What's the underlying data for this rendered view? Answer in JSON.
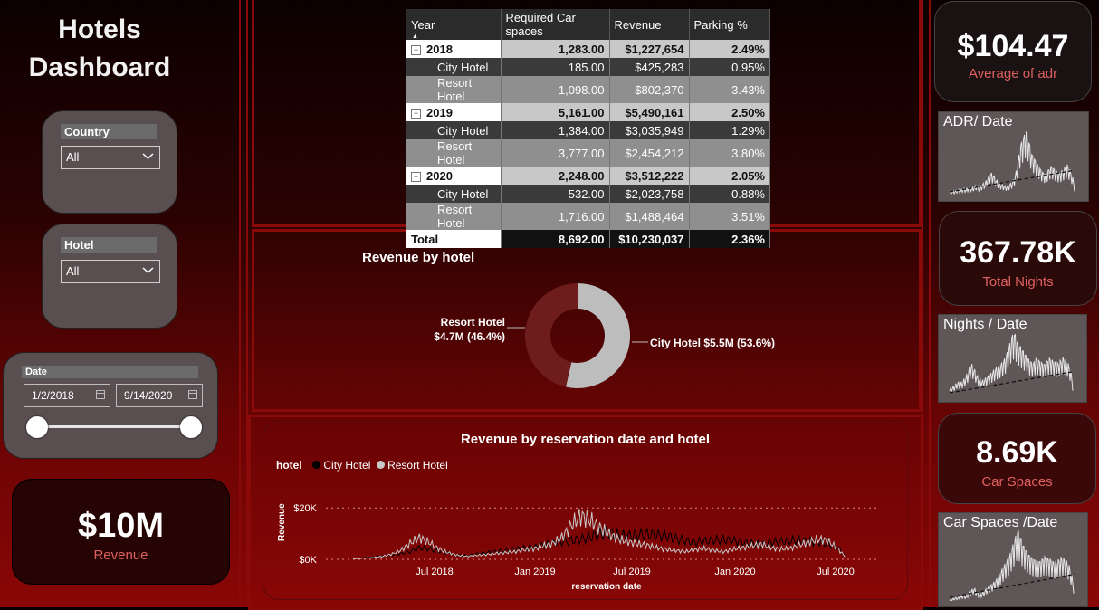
{
  "title": {
    "line1": "Hotels",
    "line2": "Dashboard"
  },
  "slicers": {
    "country": {
      "label": "Country",
      "value": "All"
    },
    "hotel": {
      "label": "Hotel",
      "value": "All"
    },
    "date": {
      "label": "Date",
      "start": "1/2/2018",
      "end": "9/14/2020"
    }
  },
  "revenue_card": {
    "value": "$10M",
    "label": "Revenue"
  },
  "kpis": {
    "adr": {
      "value": "$104.47",
      "label": "Average of adr"
    },
    "nights": {
      "value": "367.78K",
      "label": "Total Nights"
    },
    "car": {
      "value": "8.69K",
      "label": "Car Spaces"
    }
  },
  "mini_charts": {
    "adr": {
      "title": "ADR/ Date"
    },
    "nights": {
      "title": "Nights / Date"
    },
    "car": {
      "title": "Car Spaces /Date"
    }
  },
  "matrix": {
    "headers": [
      "Year",
      "Required Car spaces",
      "Revenue",
      "Parking %"
    ],
    "rows": [
      {
        "type": "year",
        "cells": [
          "2018",
          "1,283.00",
          "$1,227,654",
          "2.49%"
        ]
      },
      {
        "type": "dark",
        "cells": [
          "City Hotel",
          "185.00",
          "$425,283",
          "0.95%"
        ]
      },
      {
        "type": "mid",
        "cells": [
          "Resort Hotel",
          "1,098.00",
          "$802,370",
          "3.43%"
        ]
      },
      {
        "type": "year",
        "cells": [
          "2019",
          "5,161.00",
          "$5,490,161",
          "2.50%"
        ]
      },
      {
        "type": "dark",
        "cells": [
          "City Hotel",
          "1,384.00",
          "$3,035,949",
          "1.29%"
        ]
      },
      {
        "type": "mid",
        "cells": [
          "Resort Hotel",
          "3,777.00",
          "$2,454,212",
          "3.80%"
        ]
      },
      {
        "type": "year",
        "cells": [
          "2020",
          "2,248.00",
          "$3,512,222",
          "2.05%"
        ]
      },
      {
        "type": "dark",
        "cells": [
          "City Hotel",
          "532.00",
          "$2,023,758",
          "0.88%"
        ]
      },
      {
        "type": "mid",
        "cells": [
          "Resort Hotel",
          "1,716.00",
          "$1,488,464",
          "3.51%"
        ]
      },
      {
        "type": "total",
        "cells": [
          "Total",
          "8,692.00",
          "$10,230,037",
          "2.36%"
        ]
      }
    ]
  },
  "chart_data": [
    {
      "type": "pie",
      "title": "Revenue by hotel",
      "slices": [
        {
          "name": "City Hotel",
          "value": 5.5,
          "percent": 53.6,
          "label": "City Hotel $5.5M (53.6%)",
          "color": "#bdbdbd"
        },
        {
          "name": "Resort Hotel",
          "value": 4.7,
          "percent": 46.4,
          "label_line1": "Resort Hotel",
          "label_line2": "$4.7M (46.4%)",
          "color": "#6e1c1c"
        }
      ]
    },
    {
      "type": "line",
      "title": "Revenue by reservation date and hotel",
      "legend_title": "hotel",
      "xlabel": "reservation date",
      "ylabel": "Revenue",
      "yticks": [
        "$0K",
        "$20K"
      ],
      "xticks": [
        "Jul 2018",
        "Jan 2019",
        "Jul 2019",
        "Jan 2020",
        "Jul 2020"
      ],
      "ylim": [
        0,
        25
      ],
      "series": [
        {
          "name": "City Hotel",
          "color": "#000000",
          "values": [
            0.3,
            0.5,
            0.8,
            1.2,
            1.5,
            2,
            2.8,
            4.2,
            3.8,
            2.9,
            2.2,
            1.6,
            1.3,
            1.9,
            2.4,
            2.8,
            3.2,
            3.7,
            4.1,
            4.4,
            5,
            5.8,
            6.4,
            6.9,
            7.3,
            8.1,
            9.3,
            9.8,
            8.7,
            8.4,
            8.9,
            9.1,
            8.8,
            8.6,
            7.4,
            6.8,
            6.2,
            6.6,
            6.9,
            7.1,
            6.8,
            6.1,
            5.8,
            5.3,
            6.1,
            6.4,
            6.8,
            6.9,
            6.5,
            6.4,
            5.6,
            4.6,
            0.8
          ]
        },
        {
          "name": "Resort Hotel",
          "color": "#c8c8c8",
          "values": [
            0.2,
            0.4,
            0.6,
            1,
            1.8,
            3.2,
            5.8,
            7.9,
            6.2,
            3.8,
            2.4,
            1.5,
            1.1,
            1.4,
            1.7,
            2.1,
            2.4,
            2.7,
            3.4,
            3.8,
            4.8,
            5.7,
            7.9,
            12.4,
            15.8,
            14.2,
            11.6,
            9.1,
            7.3,
            6.4,
            5.6,
            5.1,
            4.2,
            3.6,
            3.2,
            2.8,
            3.4,
            3.9,
            3.3,
            2.7,
            3.6,
            4.2,
            4.8,
            5.6,
            4.3,
            3.7,
            3.9,
            5.1,
            6.2,
            7.3,
            6.8,
            4.1,
            0.5
          ]
        }
      ]
    },
    {
      "type": "area",
      "title": "ADR/ Date",
      "values": [
        5,
        6,
        6,
        8,
        7,
        9,
        8,
        10,
        9,
        11,
        12,
        10,
        13,
        15,
        20,
        25,
        23,
        18,
        15,
        13,
        12,
        11,
        13,
        16,
        22,
        38,
        55,
        62,
        70,
        58,
        45,
        40,
        35,
        30,
        26,
        24,
        28,
        32,
        30,
        27,
        25,
        27,
        30,
        33,
        28,
        20,
        5
      ]
    },
    {
      "type": "area",
      "title": "Nights / Date",
      "values": [
        8,
        10,
        12,
        15,
        14,
        16,
        20,
        25,
        32,
        28,
        22,
        18,
        16,
        18,
        20,
        22,
        25,
        28,
        30,
        32,
        35,
        40,
        48,
        58,
        62,
        55,
        50,
        46,
        42,
        38,
        35,
        33,
        38,
        36,
        34,
        32,
        35,
        38,
        36,
        34,
        33,
        35,
        38,
        36,
        32,
        25,
        5
      ]
    },
    {
      "type": "area",
      "title": "Car Spaces /Date",
      "values": [
        2,
        3,
        4,
        4,
        5,
        6,
        5,
        8,
        10,
        12,
        9,
        7,
        8,
        10,
        12,
        14,
        16,
        18,
        22,
        26,
        30,
        34,
        38,
        45,
        52,
        60,
        55,
        48,
        44,
        40,
        38,
        36,
        35,
        34,
        36,
        38,
        37,
        36,
        34,
        33,
        35,
        37,
        36,
        34,
        30,
        22,
        8
      ]
    }
  ]
}
